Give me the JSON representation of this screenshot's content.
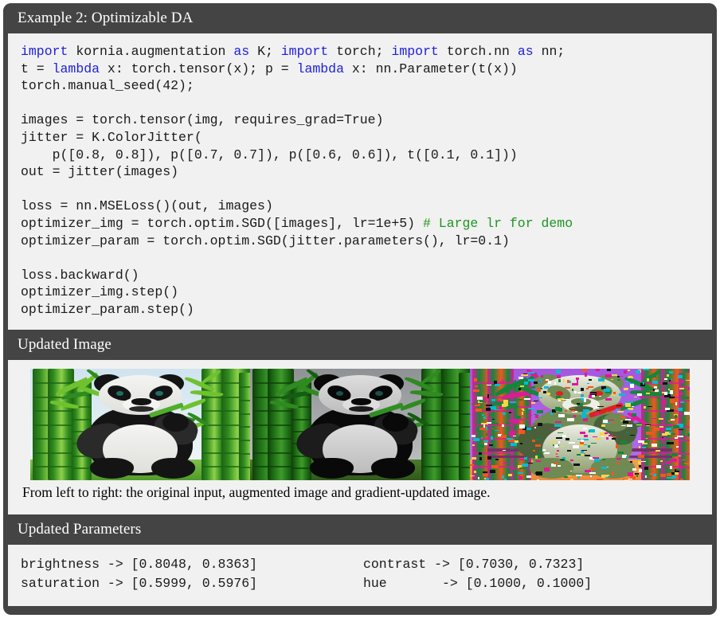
{
  "figure": {
    "title": "Example 2: Optimizable DA",
    "frame_color": "#444444",
    "panel_color": "#f1f1f1"
  },
  "code_section": {
    "header": "Example 2: Optimizable DA",
    "language": "python",
    "lines": [
      {
        "segments": [
          {
            "t": "import",
            "s": "kw"
          },
          {
            "t": " kornia.augmentation ",
            "s": ""
          },
          {
            "t": "as",
            "s": "kw"
          },
          {
            "t": " K; ",
            "s": ""
          },
          {
            "t": "import",
            "s": "kw"
          },
          {
            "t": " torch; ",
            "s": ""
          },
          {
            "t": "import",
            "s": "kw"
          },
          {
            "t": " torch.nn ",
            "s": ""
          },
          {
            "t": "as",
            "s": "kw"
          },
          {
            "t": " nn;",
            "s": ""
          }
        ]
      },
      {
        "segments": [
          {
            "t": "t = ",
            "s": ""
          },
          {
            "t": "lambda",
            "s": "kw"
          },
          {
            "t": " x: torch.tensor(x); p = ",
            "s": ""
          },
          {
            "t": "lambda",
            "s": "kw"
          },
          {
            "t": " x: nn.Parameter(t(x))",
            "s": ""
          }
        ]
      },
      {
        "segments": [
          {
            "t": "torch.manual_seed(42);",
            "s": ""
          }
        ]
      },
      {
        "segments": [
          {
            "t": "",
            "s": ""
          }
        ]
      },
      {
        "segments": [
          {
            "t": "images = torch.tensor(img, requires_grad=True)",
            "s": ""
          }
        ]
      },
      {
        "segments": [
          {
            "t": "jitter = K.ColorJitter(",
            "s": ""
          }
        ]
      },
      {
        "segments": [
          {
            "t": "    p([0.8, 0.8]), p([0.7, 0.7]), p([0.6, 0.6]), t([0.1, 0.1]))",
            "s": ""
          }
        ]
      },
      {
        "segments": [
          {
            "t": "out = jitter(images)",
            "s": ""
          }
        ]
      },
      {
        "segments": [
          {
            "t": "",
            "s": ""
          }
        ]
      },
      {
        "segments": [
          {
            "t": "loss = nn.MSELoss()(out, images)",
            "s": ""
          }
        ]
      },
      {
        "segments": [
          {
            "t": "optimizer_img = torch.optim.SGD([images], lr=1e+5) ",
            "s": ""
          },
          {
            "t": "# Large lr for demo",
            "s": "cmt"
          }
        ]
      },
      {
        "segments": [
          {
            "t": "optimizer_param = torch.optim.SGD(jitter.parameters(), lr=0.1)",
            "s": ""
          }
        ]
      },
      {
        "segments": [
          {
            "t": "",
            "s": ""
          }
        ]
      },
      {
        "segments": [
          {
            "t": "loss.backward()",
            "s": ""
          }
        ]
      },
      {
        "segments": [
          {
            "t": "optimizer_img.step()",
            "s": ""
          }
        ]
      },
      {
        "segments": [
          {
            "t": "optimizer_param.step()",
            "s": ""
          }
        ]
      }
    ],
    "syntax_colors": {
      "keyword": "#2020e0",
      "comment": "#1f9620",
      "text": "#1a1a1a"
    }
  },
  "image_section": {
    "header": "Updated Image",
    "caption": "From left to right: the original input, augmented image and gradient-updated image.",
    "thumbnails": [
      {
        "name": "original-input",
        "alt": "Panda eating bamboo in a bamboo forest, original photo"
      },
      {
        "name": "augmented-image",
        "alt": "Same panda photo after ColorJitter augmentation, darker and desaturated"
      },
      {
        "name": "gradient-updated-image",
        "alt": "Same panda photo after a large gradient step, heavily posterized with purple sky and orange ground"
      }
    ]
  },
  "params_section": {
    "header": "Updated Parameters",
    "rows": [
      {
        "left": "brightness -> [0.8048, 0.8363]",
        "right": "contrast -> [0.7030, 0.7323]"
      },
      {
        "left": "saturation -> [0.5999, 0.5976]",
        "right": "hue       -> [0.1000, 0.1000]"
      }
    ],
    "values": {
      "brightness": [
        0.8048,
        0.8363
      ],
      "contrast": [
        0.703,
        0.7323
      ],
      "saturation": [
        0.5999,
        0.5976
      ],
      "hue": [
        0.1,
        0.1
      ]
    }
  }
}
